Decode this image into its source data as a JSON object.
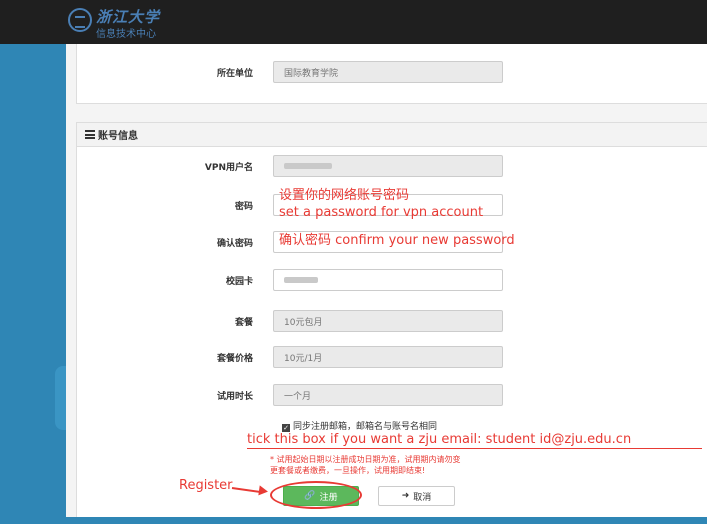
{
  "header": {
    "logo_title": "浙江大学",
    "logo_subtitle": "信息技术中心"
  },
  "top_section": {
    "unit_label": "所在单位",
    "unit_value": "国际教育学院"
  },
  "account_section": {
    "title": "账号信息",
    "vpn_username_label": "VPN用户名",
    "password_label": "密码",
    "confirm_password_label": "确认密码",
    "campus_card_label": "校园卡",
    "package_label": "套餐",
    "package_value": "10元包月",
    "price_label": "套餐价格",
    "price_value": "10元/1月",
    "trial_label": "试用时长",
    "trial_value": "一个月",
    "sync_email_text": "同步注册邮箱，邮箱名与账号名相同",
    "notice_line1": "* 试用起始日期以注册成功日期为准，试用期内请勿变",
    "notice_line2": "更套餐或者缴费，一旦操作，试用期即结束!"
  },
  "buttons": {
    "register_label": "注册",
    "cancel_label": "取消"
  },
  "annotations": {
    "password_cn": "设置你的网络账号密码",
    "password_en": "set a password for vpn account",
    "confirm": "确认密码 confirm your new password",
    "email_tip": "tick this box if you want a zju email: student id@zju.edu.cn",
    "register": "Register"
  },
  "colors": {
    "annotation_red": "#e83a34",
    "register_green": "#5cb85c",
    "side_blue": "#2f86b5",
    "topbar": "#1f1f1f"
  }
}
